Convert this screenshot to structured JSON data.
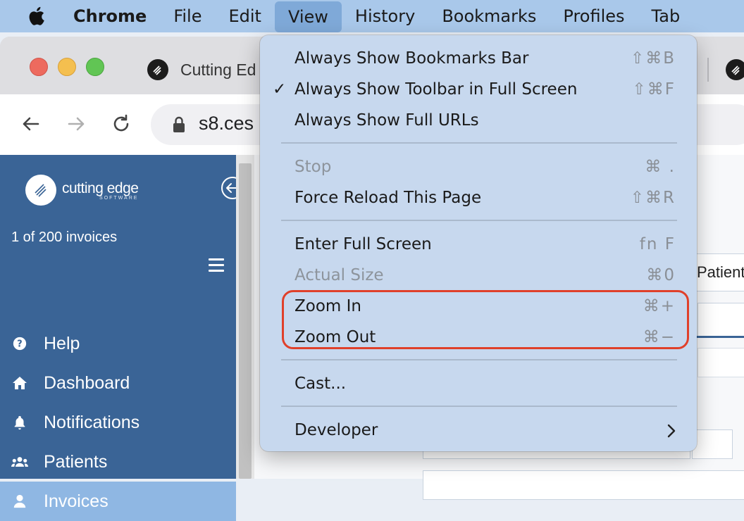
{
  "menubar": {
    "app_name": "Chrome",
    "items": [
      "File",
      "Edit",
      "View",
      "History",
      "Bookmarks",
      "Profiles",
      "Tab"
    ],
    "active_item": "View"
  },
  "browser": {
    "tab_title": "Cutting Ed",
    "url": "s8.ces"
  },
  "view_menu": {
    "items": [
      {
        "label": "Always Show Bookmarks Bar",
        "shortcut": "⇧⌘B",
        "checked": false,
        "disabled": false
      },
      {
        "label": "Always Show Toolbar in Full Screen",
        "shortcut": "⇧⌘F",
        "checked": true,
        "disabled": false
      },
      {
        "label": "Always Show Full URLs",
        "shortcut": "",
        "checked": false,
        "disabled": false
      },
      {
        "label": "Stop",
        "shortcut": "⌘ .",
        "checked": false,
        "disabled": true
      },
      {
        "label": "Force Reload This Page",
        "shortcut": "⇧⌘R",
        "checked": false,
        "disabled": false
      },
      {
        "label": "Enter Full Screen",
        "shortcut": "fn F",
        "checked": false,
        "disabled": false
      },
      {
        "label": "Actual Size",
        "shortcut": "⌘0",
        "checked": false,
        "disabled": true
      },
      {
        "label": "Zoom In",
        "shortcut": "⌘+",
        "checked": false,
        "disabled": false
      },
      {
        "label": "Zoom Out",
        "shortcut": "⌘−",
        "checked": false,
        "disabled": false
      },
      {
        "label": "Cast...",
        "shortcut": "",
        "checked": false,
        "disabled": false
      },
      {
        "label": "Developer",
        "shortcut": "",
        "checked": false,
        "disabled": false,
        "submenu": true
      }
    ],
    "check_glyph": "✓"
  },
  "app": {
    "logo_name": "cutting edge",
    "logo_sub": "SOFTWARE",
    "invoice_counter": "1 of 200 invoices",
    "nav": [
      {
        "label": "Help",
        "icon": "help-icon"
      },
      {
        "label": "Dashboard",
        "icon": "home-icon"
      },
      {
        "label": "Notifications",
        "icon": "bell-icon"
      },
      {
        "label": "Patients",
        "icon": "users-icon"
      },
      {
        "label": "Invoices",
        "icon": "user-icon",
        "active": true
      }
    ],
    "right_tab_label": "Patient D"
  },
  "colors": {
    "menubar_bg": "#a9c8ea",
    "sidebar_bg": "#3a6496",
    "sidebar_active": "#8fb7e3",
    "highlight": "#e0402a"
  }
}
